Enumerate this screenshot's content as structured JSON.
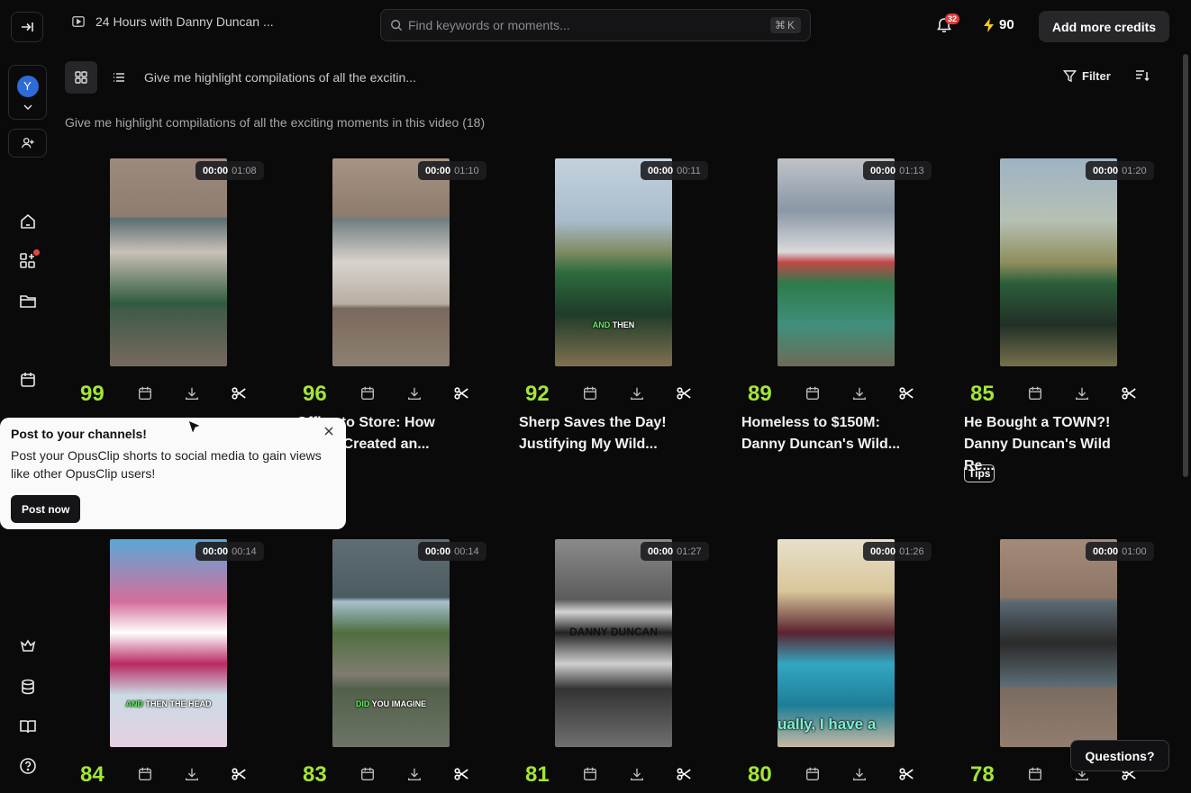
{
  "header": {
    "video_title": "24 Hours with Danny Duncan ...",
    "search_placeholder": "Find keywords or moments...",
    "search_shortcut": "⌘K",
    "notification_count": "32",
    "credits": "90",
    "add_credits_label": "Add more credits"
  },
  "sidebar": {
    "workspace_initial": "Y"
  },
  "toolbar": {
    "prompt_short": "Give me highlight compilations of all the excitin...",
    "filter_label": "Filter"
  },
  "prompt_heading": "Give me highlight compilations of all the exciting moments in this video  (18)",
  "clips": [
    {
      "start": "00:00",
      "duration": "01:08",
      "score": "99",
      "title": "",
      "tag": ""
    },
    {
      "start": "00:00",
      "duration": "01:10",
      "score": "96",
      "title": "Office to Store: How\nMerch Created an...",
      "tag": ""
    },
    {
      "start": "00:00",
      "duration": "00:11",
      "score": "92",
      "title": "Sherp Saves the Day!\nJustifying My Wild...",
      "tag": "",
      "caption": [
        "AND",
        " THEN"
      ]
    },
    {
      "start": "00:00",
      "duration": "01:13",
      "score": "89",
      "title": "Homeless to $150M:\nDanny Duncan's Wild...",
      "tag": ""
    },
    {
      "start": "00:00",
      "duration": "01:20",
      "score": "85",
      "title": "He Bought a TOWN?!\nDanny Duncan's Wild Re...",
      "tag": "Tips"
    },
    {
      "start": "00:00",
      "duration": "00:14",
      "score": "84",
      "title": "",
      "tag": "",
      "caption": [
        "AND",
        " THEN THE HEAD"
      ]
    },
    {
      "start": "00:00",
      "duration": "00:14",
      "score": "83",
      "title": "",
      "tag": "",
      "caption": [
        "DID",
        " YOU IMAGINE"
      ]
    },
    {
      "start": "00:00",
      "duration": "01:27",
      "score": "81",
      "title": "",
      "tag": "",
      "sign": "DANNY DUNCAN"
    },
    {
      "start": "00:00",
      "duration": "01:26",
      "score": "80",
      "title": "",
      "tag": "",
      "subtitle": "ually, I have a"
    },
    {
      "start": "00:00",
      "duration": "01:00",
      "score": "78",
      "title": "",
      "tag": ""
    }
  ],
  "popup": {
    "title": "Post to your channels!",
    "body": "Post your OpusClip shorts to social media to gain views like other OpusClip users!",
    "button": "Post now"
  },
  "questions_label": "Questions?",
  "colors": {
    "score": "#a3e635",
    "accent_badge": "#e23b3b"
  }
}
